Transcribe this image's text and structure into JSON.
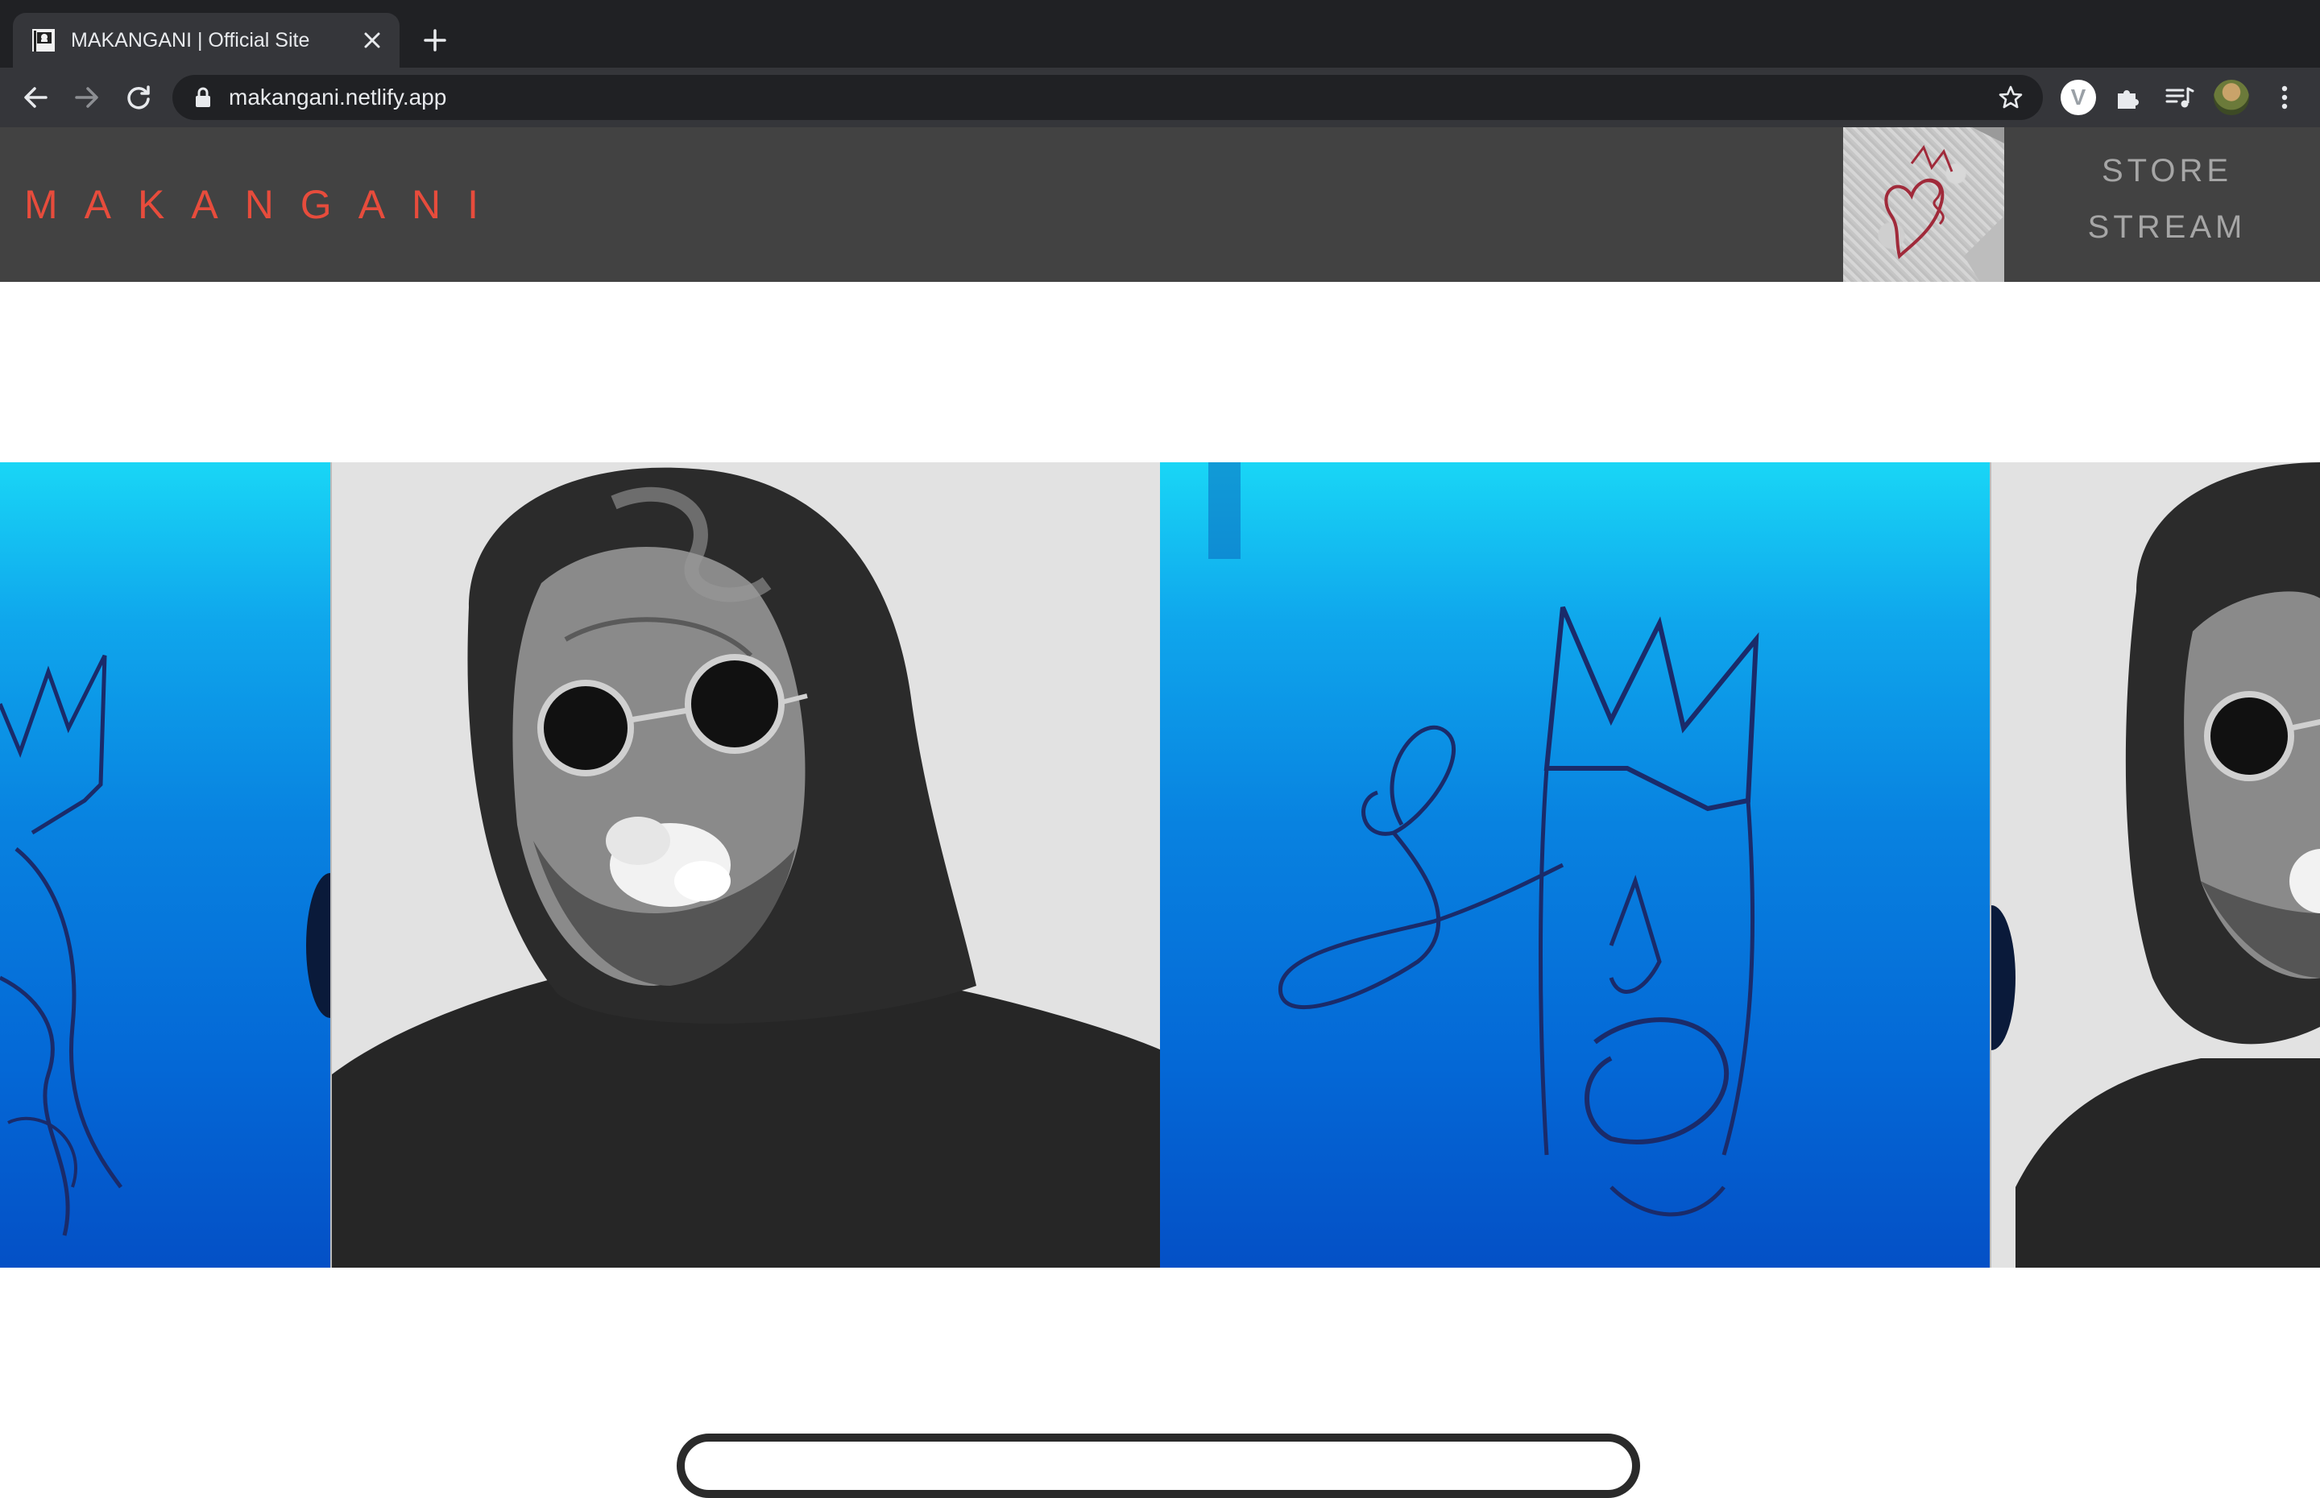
{
  "browser": {
    "tab_title": "MAKANGANI | Official Site",
    "url": "makangani.netlify.app",
    "extension_letter": "V"
  },
  "site": {
    "brand": "MAKANGANI",
    "nav": [
      "STORE",
      "STREAM"
    ],
    "brand_color": "#e74c3c",
    "header_bg": "#424242",
    "nav_color": "#a6a6a6"
  },
  "icons": {
    "favicon": "flag-favicon-icon",
    "close": "close-icon",
    "new_tab": "plus-icon",
    "back": "arrow-left-icon",
    "forward": "arrow-right-icon",
    "reload": "reload-icon",
    "lock": "lock-icon",
    "bookmark": "star-icon",
    "extensions": "puzzle-icon",
    "media": "media-queue-icon",
    "menu": "kebab-menu-icon"
  }
}
